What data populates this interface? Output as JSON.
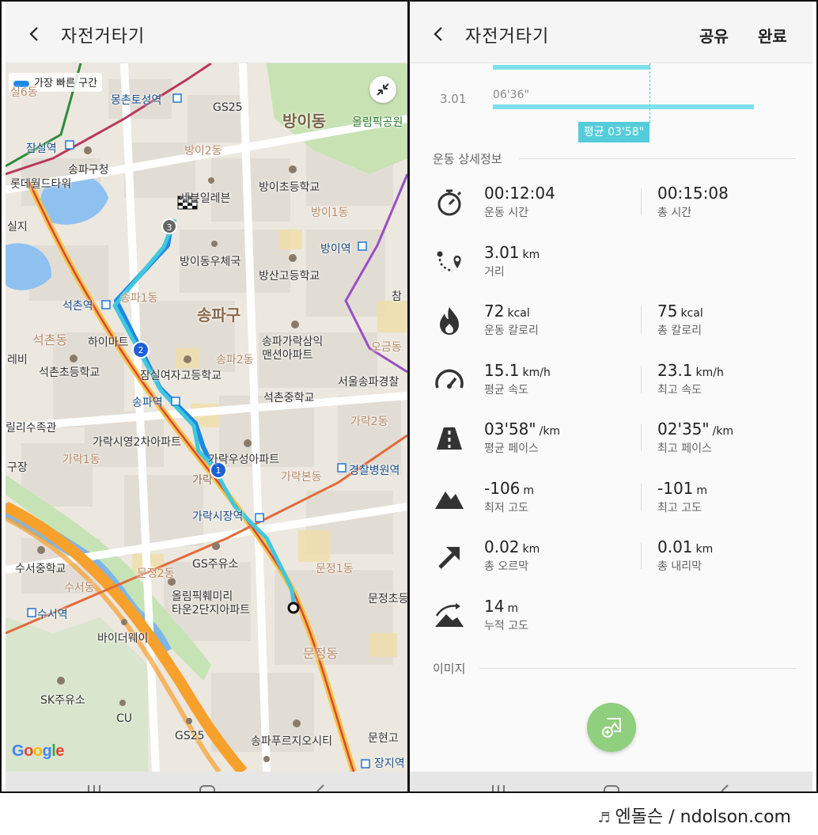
{
  "left": {
    "title": "자전거타기",
    "legend": "가장 빠른 구간",
    "google": "Google",
    "markers": [
      "1",
      "2",
      "3"
    ],
    "labels": {
      "silyuk": "실6동",
      "mongchon": "몽촌토성역",
      "gs25_top": "GS25",
      "bangi_dong": "방이동",
      "olympic_park": "올림픽공원",
      "jamsil": "잠실역",
      "songpa_gu_office": "송파구청",
      "lotte_world": "롯데월드타워",
      "bangi2": "방이2동",
      "seven": "세븐일레븐",
      "bangi_elem": "방이초등학교",
      "bangi1": "방이1동",
      "silji": "실지",
      "bangi_station": "방이역",
      "bangi_post": "방이동우체국",
      "bangsan_high": "방산고등학교",
      "seokchon_station": "석촌역",
      "songpa1": "송파1동",
      "songpa_gu": "송파구",
      "cham": "참",
      "seokchon_dong": "석촌동",
      "himart": "하이마트",
      "songpa_garak": "송파가락삼익\n맨션아파트",
      "ogeum": "오금동",
      "rebi": "레비",
      "seokchon_elem": "석촌초등학교",
      "jamsil_girls": "잠실여자고등학교",
      "songpa2": "송파2동",
      "seoul_songpa": "서울송파경찰",
      "songpa_station": "송파역",
      "seokchon_middle": "석촌중학교",
      "lily": "릴리수족관",
      "garak2": "가락2동",
      "garak_apt": "가락시영2차아파트",
      "guzang": "구장",
      "garak1": "가락1동",
      "garak_woosung": "가락우성아파트",
      "garak_station": "가락",
      "garakbon": "가락본동",
      "police_hospital": "경찰병원역",
      "garak_market": "가락시장역",
      "suseo_middle": "수서중학교",
      "gs_station": "GS주유소",
      "munjeong2": "문정2동",
      "munjeong1": "문정1동",
      "suseo_dong": "수서동",
      "munjeong_elem": "문정초등",
      "suseo_station": "수서역",
      "olympic_family": "올림픽훼미리\n타운2단지아파트",
      "bidway": "바이더웨이",
      "munjeong_dong": "문정동",
      "sk": "SK주유소",
      "cu": "CU",
      "gs25_bottom": "GS25",
      "songpa_prugio": "송파푸르지오시티",
      "munhyeon": "문현고",
      "jangji": "장지역"
    }
  },
  "right": {
    "title": "자전거타기",
    "share": "공유",
    "done": "완료",
    "pace_chart": {
      "segment_label": "3.01",
      "segment_value": "06'36\"",
      "avg_label": "평균 03'58\""
    },
    "section_detail": "운동 상세정보",
    "section_image": "이미지",
    "rows": [
      {
        "icon": "stopwatch-icon",
        "a": {
          "value": "00:12:04",
          "unit": "",
          "label": "운동 시간"
        },
        "b": {
          "value": "00:15:08",
          "unit": "",
          "label": "총 시간"
        }
      },
      {
        "icon": "route-icon",
        "a": {
          "value": "3.01",
          "unit": "km",
          "label": "거리"
        },
        "b": null
      },
      {
        "icon": "flame-icon",
        "a": {
          "value": "72",
          "unit": "kcal",
          "label": "운동 칼로리"
        },
        "b": {
          "value": "75",
          "unit": "kcal",
          "label": "총 칼로리"
        }
      },
      {
        "icon": "speedometer-icon",
        "a": {
          "value": "15.1",
          "unit": "km/h",
          "label": "평균 속도"
        },
        "b": {
          "value": "23.1",
          "unit": "km/h",
          "label": "최고 속도"
        }
      },
      {
        "icon": "road-icon",
        "a": {
          "value": "03'58\"",
          "unit": "/km",
          "label": "평균 페이스"
        },
        "b": {
          "value": "02'35\"",
          "unit": "/km",
          "label": "최고 페이스"
        }
      },
      {
        "icon": "mountain-icon",
        "a": {
          "value": "-106",
          "unit": "m",
          "label": "최저 고도"
        },
        "b": {
          "value": "-101",
          "unit": "m",
          "label": "최고 고도"
        }
      },
      {
        "icon": "arrow-up-right-icon",
        "a": {
          "value": "0.02",
          "unit": "km",
          "label": "총 오르막"
        },
        "b": {
          "value": "0.01",
          "unit": "km",
          "label": "총 내리막"
        }
      },
      {
        "icon": "elevation-icon",
        "a": {
          "value": "14",
          "unit": "m",
          "label": "누적 고도"
        },
        "b": null
      }
    ]
  },
  "watermark": {
    "note": "♬",
    "text": "엔돌슨 / ndolson.com"
  },
  "colors": {
    "accent": "#55ccd9",
    "route_blue": "#1e88e5",
    "route_cyan": "#3fc8dc",
    "fab_green": "#8fcf7e"
  }
}
